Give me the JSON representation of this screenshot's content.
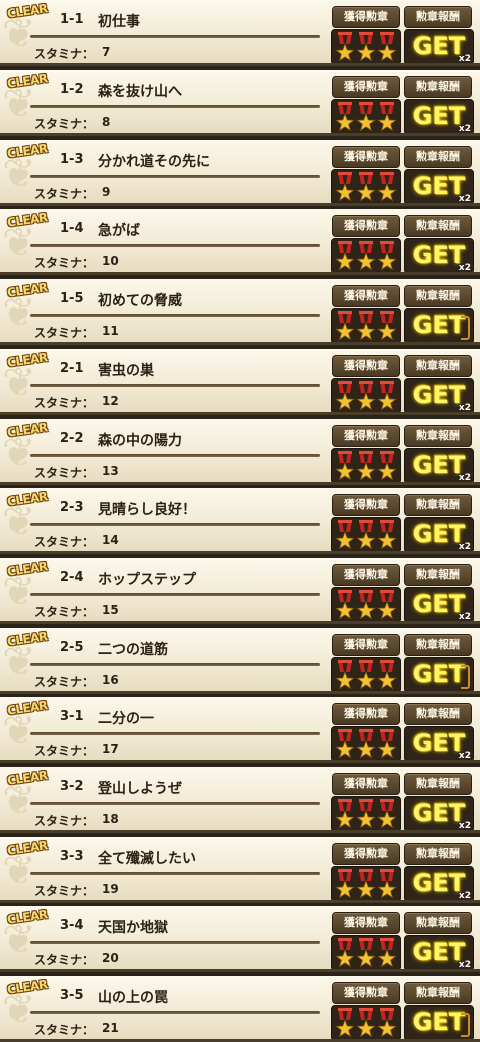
{
  "labels": {
    "clear": "CLEAR",
    "stamina": "スタミナ：",
    "acquired_medals": "獲得勲章",
    "medal_reward": "勲章報酬",
    "get": "GET"
  },
  "colors": {
    "row_background": "#f1e9d3",
    "row_border": "#4a3d2a",
    "button_background": "#5c4a30",
    "get_text": "#fff46a",
    "medal_ribbon": "#c4231f",
    "medal_star": "#f2c230"
  },
  "stages": [
    {
      "num": "1-1",
      "title": "初仕事",
      "stamina": "7",
      "multiplier": "x2"
    },
    {
      "num": "1-2",
      "title": "森を抜け山へ",
      "stamina": "8",
      "multiplier": "x2"
    },
    {
      "num": "1-3",
      "title": "分かれ道その先に",
      "stamina": "9",
      "multiplier": "x2"
    },
    {
      "num": "1-4",
      "title": "急がば",
      "stamina": "10",
      "multiplier": "x2"
    },
    {
      "num": "1-5",
      "title": "初めての脅威",
      "stamina": "11",
      "multiplier": ""
    },
    {
      "num": "2-1",
      "title": "害虫の巣",
      "stamina": "12",
      "multiplier": "x2"
    },
    {
      "num": "2-2",
      "title": "森の中の陽力",
      "stamina": "13",
      "multiplier": "x2"
    },
    {
      "num": "2-3",
      "title": "見晴らし良好！",
      "stamina": "14",
      "multiplier": "x2"
    },
    {
      "num": "2-4",
      "title": "ホップステップ",
      "stamina": "15",
      "multiplier": "x2"
    },
    {
      "num": "2-5",
      "title": "二つの道筋",
      "stamina": "16",
      "multiplier": ""
    },
    {
      "num": "3-1",
      "title": "二分の一",
      "stamina": "17",
      "multiplier": "x2"
    },
    {
      "num": "3-2",
      "title": "登山しようぜ",
      "stamina": "18",
      "multiplier": "x2"
    },
    {
      "num": "3-3",
      "title": "全て殲滅したい",
      "stamina": "19",
      "multiplier": "x2"
    },
    {
      "num": "3-4",
      "title": "天国か地獄",
      "stamina": "20",
      "multiplier": "x2"
    },
    {
      "num": "3-5",
      "title": "山の上の罠",
      "stamina": "21",
      "multiplier": ""
    }
  ]
}
